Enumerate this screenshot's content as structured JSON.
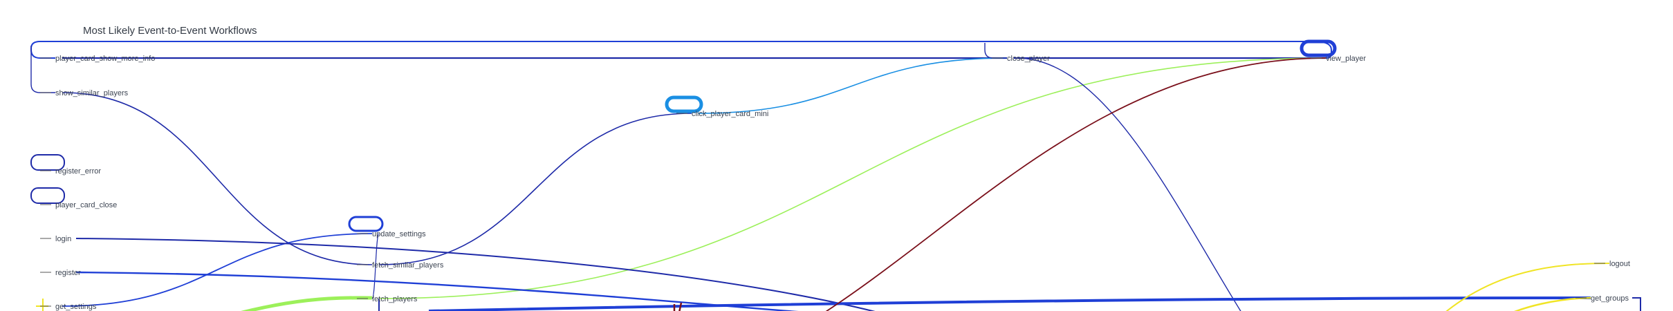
{
  "title": "Most Likely Event-to-Event Workflows",
  "colors": {
    "navy": "#1e2aa8",
    "blue": "#1f3fd6",
    "sky": "#1a8fe3",
    "lime": "#9cf05a",
    "maroon": "#7a0f1a",
    "yellow": "#f0e425",
    "node_stroke": "#2b3fd1"
  },
  "nodes": [
    {
      "id": "player_card_show_more_info",
      "label": "player_card_show_more_info"
    },
    {
      "id": "show_similar_players",
      "label": "show_similar_players"
    },
    {
      "id": "register_error",
      "label": "register_error"
    },
    {
      "id": "player_card_close",
      "label": "player_card_close"
    },
    {
      "id": "login",
      "label": "login"
    },
    {
      "id": "register",
      "label": "register"
    },
    {
      "id": "get_settings",
      "label": "get_settings"
    },
    {
      "id": "update_settings",
      "label": "update_settings"
    },
    {
      "id": "fetch_similar_players",
      "label": "fetch_similar_players"
    },
    {
      "id": "fetch_players",
      "label": "fetch_players"
    },
    {
      "id": "click_player_card_mini",
      "label": "click_player_card_mini"
    },
    {
      "id": "close_player",
      "label": "close_player"
    },
    {
      "id": "view_player",
      "label": "view_player"
    },
    {
      "id": "logout",
      "label": "logout"
    },
    {
      "id": "get_groups",
      "label": "get_groups"
    }
  ]
}
